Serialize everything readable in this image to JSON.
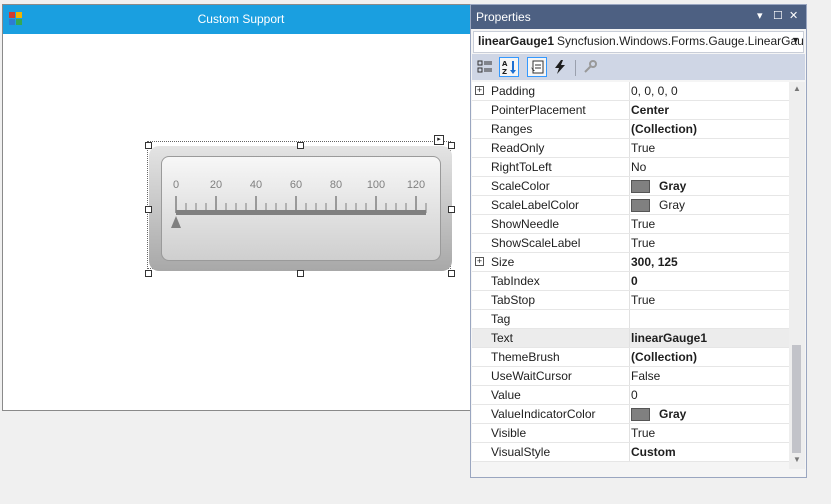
{
  "form": {
    "title": "Custom Support",
    "icon": "winforms-app-icon"
  },
  "gauge": {
    "scale_labels": [
      "0",
      "20",
      "40",
      "60",
      "80",
      "100",
      "120"
    ],
    "min": 0,
    "max": 125,
    "value": 0,
    "scale_color": "#808080",
    "indicator_color": "#808080"
  },
  "properties": {
    "title": "Properties",
    "title_buttons": {
      "dropdown": "▾",
      "maximize": "☐",
      "close": "✕"
    },
    "object_name": "linearGauge1",
    "object_type": "Syncfusion.Windows.Forms.Gauge.LinearGauge",
    "toolbar": [
      "categorized-icon",
      "alphabetical-icon",
      "properties-icon",
      "events-icon",
      "property-pages-icon"
    ],
    "rows": [
      {
        "name": "Padding",
        "value": "0, 0, 0, 0",
        "bold": false,
        "expandable": true
      },
      {
        "name": "PointerPlacement",
        "value": "Center",
        "bold": true
      },
      {
        "name": "Ranges",
        "value": "(Collection)",
        "bold": true
      },
      {
        "name": "ReadOnly",
        "value": "True",
        "bold": false
      },
      {
        "name": "RightToLeft",
        "value": "No",
        "bold": false
      },
      {
        "name": "ScaleColor",
        "value": "Gray",
        "bold": true,
        "swatch": "#808080"
      },
      {
        "name": "ScaleLabelColor",
        "value": "Gray",
        "bold": false,
        "swatch": "#808080"
      },
      {
        "name": "ShowNeedle",
        "value": "True",
        "bold": false
      },
      {
        "name": "ShowScaleLabel",
        "value": "True",
        "bold": false
      },
      {
        "name": "Size",
        "value": "300, 125",
        "bold": true,
        "expandable": true
      },
      {
        "name": "TabIndex",
        "value": "0",
        "bold": true
      },
      {
        "name": "TabStop",
        "value": "True",
        "bold": false
      },
      {
        "name": "Tag",
        "value": "",
        "bold": false
      },
      {
        "name": "Text",
        "value": "linearGauge1",
        "bold": true,
        "selected": true
      },
      {
        "name": "ThemeBrush",
        "value": "(Collection)",
        "bold": true
      },
      {
        "name": "UseWaitCursor",
        "value": "False",
        "bold": false
      },
      {
        "name": "Value",
        "value": "0",
        "bold": false
      },
      {
        "name": "ValueIndicatorColor",
        "value": "Gray",
        "bold": true,
        "swatch": "#808080"
      },
      {
        "name": "Visible",
        "value": "True",
        "bold": false
      },
      {
        "name": "VisualStyle",
        "value": "Custom",
        "bold": true
      }
    ]
  },
  "colors": {
    "form_titlebar": "#1a9fe0",
    "props_titlebar": "#4d6082",
    "selection_border": "#3399ff"
  }
}
